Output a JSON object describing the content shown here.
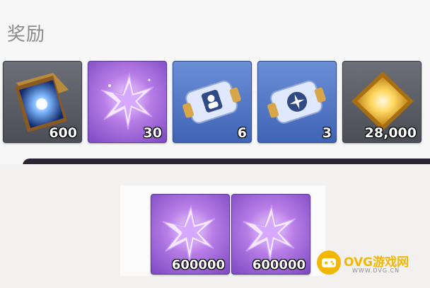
{
  "section": {
    "title": "奖励"
  },
  "rewards": [
    {
      "icon": "tome-icon",
      "quantity": "600"
    },
    {
      "icon": "star-crystal-icon",
      "quantity": "30"
    },
    {
      "icon": "portrait-ticket-icon",
      "quantity": "6"
    },
    {
      "icon": "star-ticket-icon",
      "quantity": "3"
    },
    {
      "icon": "gold-gem-icon",
      "quantity": "28,000"
    }
  ],
  "lower_rewards": [
    {
      "icon": "star-crystal-icon",
      "quantity": "600000"
    },
    {
      "icon": "star-crystal-icon",
      "quantity": "600000"
    }
  ],
  "watermark": {
    "label": "OVG游戏网",
    "url": "WWW.DVG.CN"
  },
  "colors": {
    "accent": "#f2b705",
    "title_gray": "#8a8a8a"
  }
}
